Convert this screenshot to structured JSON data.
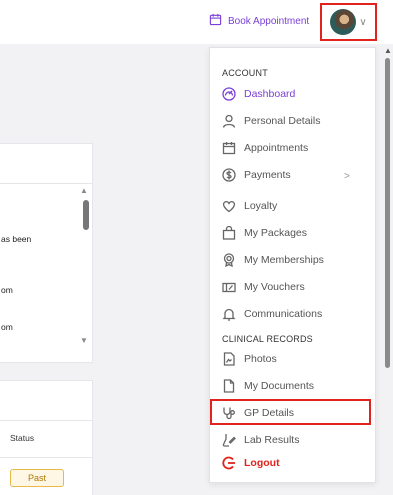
{
  "header": {
    "book_label": "Book Appointment",
    "avatar_chevron": "∨"
  },
  "background": {
    "card1_rows": [
      "as been",
      "om",
      "om"
    ],
    "card2_status": "Status",
    "card2_badge": "Past"
  },
  "menu": {
    "account_heading": "ACCOUNT",
    "clinical_heading": "CLINICAL RECORDS",
    "items": [
      {
        "label": "Dashboard",
        "icon": "gauge-icon"
      },
      {
        "label": "Personal Details",
        "icon": "person-icon"
      },
      {
        "label": "Appointments",
        "icon": "calendar-icon"
      },
      {
        "label": "Payments",
        "icon": "dollar-icon"
      },
      {
        "label": "Loyalty",
        "icon": "heart-icon"
      },
      {
        "label": "My Packages",
        "icon": "bag-icon"
      },
      {
        "label": "My Memberships",
        "icon": "badge-icon"
      },
      {
        "label": "My Vouchers",
        "icon": "voucher-icon"
      },
      {
        "label": "Communications",
        "icon": "bell-icon"
      }
    ],
    "clinical_items": [
      {
        "label": "Photos",
        "icon": "photo-icon"
      },
      {
        "label": "My Documents",
        "icon": "document-icon"
      },
      {
        "label": "GP Details",
        "icon": "stethoscope-icon"
      },
      {
        "label": "Lab Results",
        "icon": "lab-icon"
      }
    ],
    "logout_label": "Logout",
    "payments_chevron": ">"
  },
  "colors": {
    "accent": "#7a3fd6",
    "highlight": "#e0231c",
    "badge_border": "#e9b84a"
  }
}
